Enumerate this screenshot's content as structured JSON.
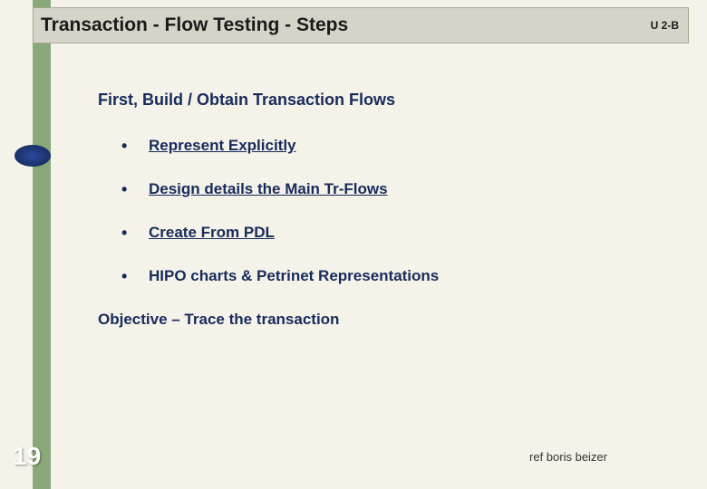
{
  "header": {
    "title": "Transaction - Flow Testing  -  Steps",
    "tag": "U 2-B"
  },
  "content": {
    "subtitle": "First, Build / Obtain Transaction Flows",
    "bullets": [
      "Represent Explicitly",
      "Design details the Main Tr-Flows",
      "Create From PDL",
      "HIPO charts & Petrinet Representations"
    ],
    "objective": "Objective – Trace the transaction"
  },
  "footer": {
    "page": "19",
    "reference": "ref boris beizer"
  }
}
